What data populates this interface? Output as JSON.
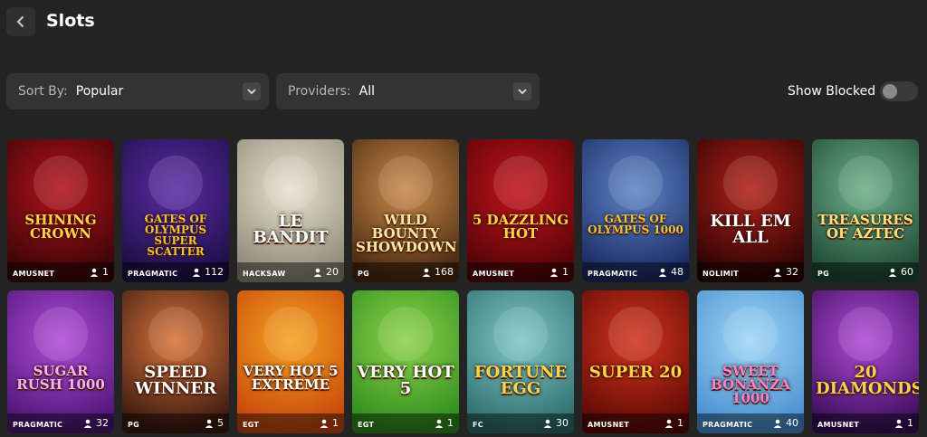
{
  "header": {
    "title": "Slots",
    "back_icon": "chevron-left-icon"
  },
  "filters": {
    "sort_label": "Sort By:",
    "sort_value": "Popular",
    "providers_label": "Providers:",
    "providers_value": "All",
    "show_blocked_label": "Show Blocked",
    "show_blocked_on": false
  },
  "games": [
    {
      "title": "SHINING CROWN",
      "provider": "AMUSNET",
      "players": "1",
      "bg": [
        "#b3121a",
        "#3a0507"
      ],
      "title_color": "#ffd24a"
    },
    {
      "title": "GATES OF OLYMPUS SUPER SCATTER",
      "provider": "PRAGMATIC",
      "players": "112",
      "bg": [
        "#5b2ba6",
        "#1d0f45"
      ],
      "title_color": "#f0c23a"
    },
    {
      "title": "LE BANDIT",
      "provider": "HACKSAW",
      "players": "20",
      "bg": [
        "#e8e2cf",
        "#8f8a77"
      ],
      "title_color": "#ffffff"
    },
    {
      "title": "WILD BOUNTY SHOWDOWN",
      "provider": "PG",
      "players": "168",
      "bg": [
        "#c98a4a",
        "#4a2a12"
      ],
      "title_color": "#ffe6a0"
    },
    {
      "title": "5 DAZZLING HOT",
      "provider": "AMUSNET",
      "players": "1",
      "bg": [
        "#c3131a",
        "#520408"
      ],
      "title_color": "#ffd24a"
    },
    {
      "title": "GATES OF OLYMPUS 1000",
      "provider": "PRAGMATIC",
      "players": "48",
      "bg": [
        "#5f86c8",
        "#1a2a63"
      ],
      "title_color": "#f0c23a"
    },
    {
      "title": "KILL EM ALL",
      "provider": "NOLIMIT",
      "players": "32",
      "bg": [
        "#b32018",
        "#2b0404"
      ],
      "title_color": "#ffffff"
    },
    {
      "title": "TREASURES OF AZTEC",
      "provider": "PG",
      "players": "60",
      "bg": [
        "#6fb08a",
        "#1f4a36"
      ],
      "title_color": "#ffe07a"
    },
    {
      "title": "SUGAR RUSH 1000",
      "provider": "PRAGMATIC",
      "players": "32",
      "bg": [
        "#b14bd8",
        "#4d1677"
      ],
      "title_color": "#ffb3e6"
    },
    {
      "title": "SPEED WINNER",
      "provider": "PG",
      "players": "5",
      "bg": [
        "#d9743a",
        "#3b1a10"
      ],
      "title_color": "#ffffff"
    },
    {
      "title": "VERY HOT 5 EXTREME",
      "provider": "EGT",
      "players": "1",
      "bg": [
        "#f5a320",
        "#c7460c"
      ],
      "title_color": "#ffffff"
    },
    {
      "title": "VERY HOT 5",
      "provider": "EGT",
      "players": "1",
      "bg": [
        "#8fd24a",
        "#2f8f1e"
      ],
      "title_color": "#ffffff"
    },
    {
      "title": "FORTUNE EGG",
      "provider": "FC",
      "players": "30",
      "bg": [
        "#7fc8c7",
        "#2f6f6e"
      ],
      "title_color": "#ffd24a"
    },
    {
      "title": "SUPER 20",
      "provider": "AMUSNET",
      "players": "1",
      "bg": [
        "#d4341e",
        "#5e0a05"
      ],
      "title_color": "#ffd24a"
    },
    {
      "title": "SWEET BONANZA 1000",
      "provider": "PRAGMATIC",
      "players": "40",
      "bg": [
        "#9fd7f5",
        "#4a8fd0"
      ],
      "title_color": "#ff7fc8"
    },
    {
      "title": "20 DIAMONDS",
      "provider": "AMUSNET",
      "players": "1",
      "bg": [
        "#b04ad8",
        "#3d0f5c"
      ],
      "title_color": "#f5d24a"
    }
  ],
  "colors": {
    "background": "#242424",
    "control": "#333333",
    "accent_text": "#b5b5b5"
  }
}
